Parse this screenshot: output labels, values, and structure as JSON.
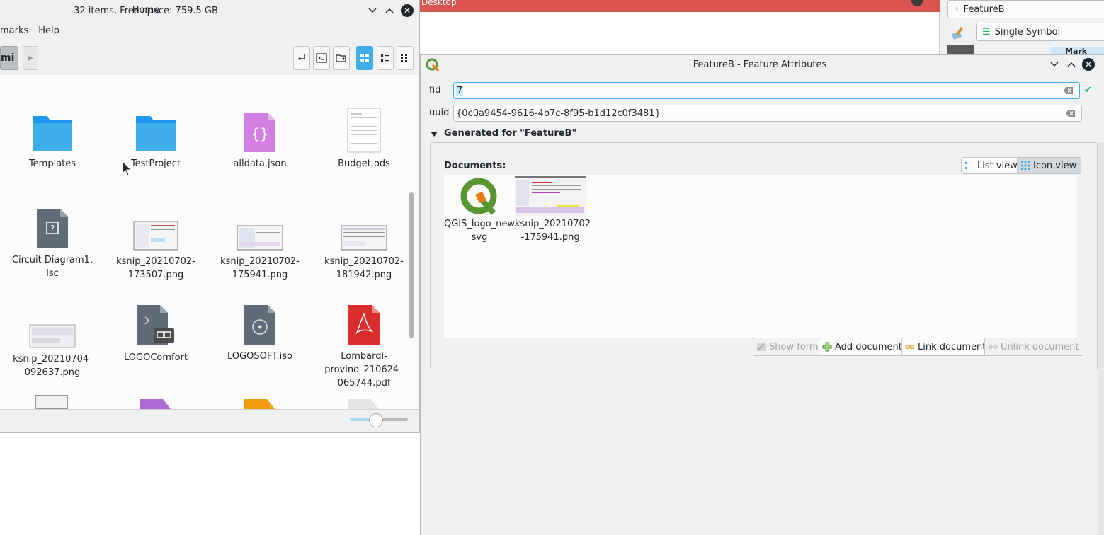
{
  "background": {
    "red_window_title": "Desktop",
    "qgis_layer_name": "FeatureB",
    "qgis_renderer": "Single Symbol",
    "qgis_tree_item": "Mark"
  },
  "file_manager": {
    "title": "Home",
    "menu": [
      "marks",
      "Help"
    ],
    "breadcrumb": "mi",
    "items": [
      {
        "name": "Templates",
        "kind": "folder"
      },
      {
        "name": "TestProject",
        "kind": "folder"
      },
      {
        "name": "alldata.json",
        "kind": "json"
      },
      {
        "name": "Budget.ods",
        "kind": "spreadsheet"
      },
      {
        "name": "Circuit Diagram1.\nlsc",
        "kind": "unknown"
      },
      {
        "name": "ksnip_20210702-\n173507.png",
        "kind": "image"
      },
      {
        "name": "ksnip_20210702-\n175941.png",
        "kind": "image"
      },
      {
        "name": "ksnip_20210702-\n181942.png",
        "kind": "image"
      },
      {
        "name": "ksnip_20210704-\n092637.png",
        "kind": "image"
      },
      {
        "name": "LOGOComfort",
        "kind": "executable"
      },
      {
        "name": "LOGOSOFT.iso",
        "kind": "disc"
      },
      {
        "name": "Lombardi-\nprovino_210624_\n065744.pdf",
        "kind": "pdf"
      }
    ],
    "status": "32 items, Free space: 759.5 GB",
    "zoom_level": 0.45
  },
  "feature_dialog": {
    "title": "FeatureB - Feature Attributes",
    "fid_label": "fid",
    "fid_value": "7",
    "uuid_label": "uuid",
    "uuid_value": "{0c0a9454-9616-4b7c-8f95-b1d12c0f3481}",
    "group_title": "Generated for \"FeatureB\"",
    "documents_label": "Documents:",
    "list_view": "List view",
    "icon_view": "Icon view",
    "documents": [
      {
        "name": "QGIS_logo_new.\nsvg",
        "kind": "qgis-logo"
      },
      {
        "name": "ksnip_20210702\n-175941.png",
        "kind": "screenshot"
      }
    ],
    "buttons": {
      "show_form": "Show form",
      "add_document": "Add document",
      "link_document": "Link document",
      "unlink_document": "Unlink document"
    }
  }
}
